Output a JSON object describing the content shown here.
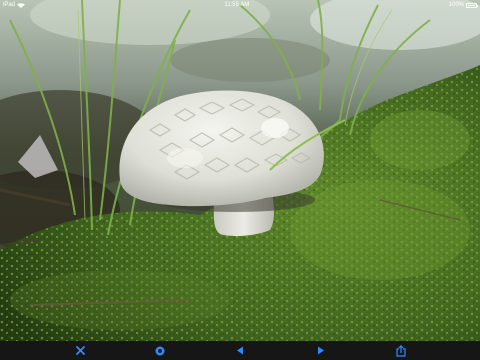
{
  "status_bar": {
    "carrier": "iPad",
    "time": "11:55 AM",
    "battery_percent": "100%",
    "battery_level": 1.0
  },
  "photo": {
    "subject_icon": "mushroom-photo"
  },
  "toolbar": {
    "buttons": [
      {
        "name": "close-button",
        "icon": "close-icon"
      },
      {
        "name": "info-button",
        "icon": "info-icon"
      },
      {
        "name": "previous-button",
        "icon": "chevron-left-icon"
      },
      {
        "name": "next-button",
        "icon": "chevron-right-icon"
      },
      {
        "name": "share-button",
        "icon": "share-icon"
      }
    ]
  },
  "colors": {
    "accent": "#2b8cff",
    "toolbar_bg": "#161616",
    "status_text": "#ffffff"
  }
}
